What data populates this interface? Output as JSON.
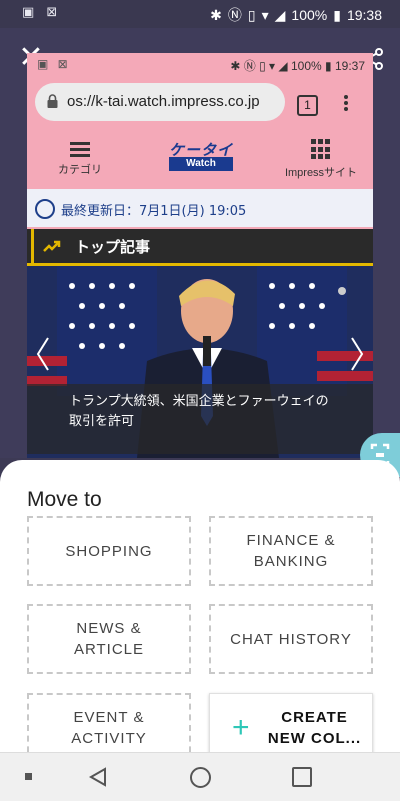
{
  "status_bar": {
    "time": "19:38",
    "battery": "100%"
  },
  "inner_screenshot": {
    "status_time": "19:37",
    "status_battery": "100%",
    "url": "os://k-tai.watch.impress.co.jp",
    "tab_count": "1",
    "nav": {
      "category_label": "カテゴリ",
      "logo_top": "ケータイ",
      "logo_bottom": "Watch",
      "impress_label": "Impressサイト"
    },
    "last_updated": "最終更新日：7月1日(月) 19:05",
    "section_title": "トップ記事",
    "caption": "トランプ大統領、米国企業とファーウェイの取引を許可"
  },
  "sheet": {
    "title": "Move to",
    "tiles": [
      "SHOPPING",
      "FINANCE & BANKING",
      "NEWS & ARTICLE",
      "CHAT HISTORY",
      "EVENT & ACTIVITY"
    ],
    "create_label": "CREATE NEW COL...",
    "accent_color": "#2ec7b7"
  }
}
